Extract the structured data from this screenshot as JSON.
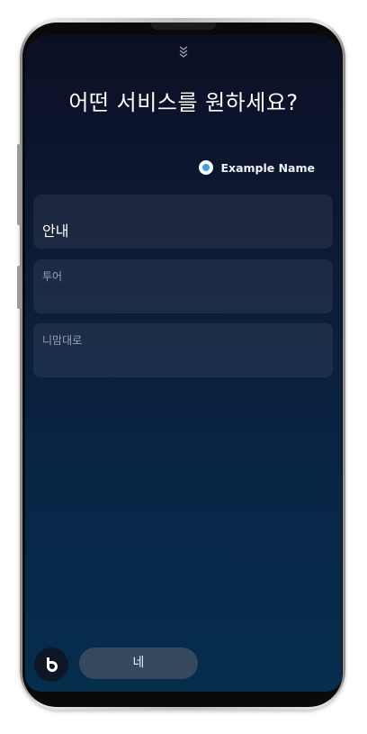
{
  "screen": {
    "title": "어떤 서비스를 원하세요?",
    "account_name": "Example Name"
  },
  "options": [
    {
      "label": "안내"
    },
    {
      "label": "투어"
    },
    {
      "label": "니맘대로"
    }
  ],
  "bottom": {
    "reply_label": "네"
  },
  "icons": {
    "pull": "chevron-double-down-icon",
    "account": "account-circle-icon",
    "assistant": "bixby-icon"
  },
  "colors": {
    "accent": "#3aa0e8",
    "chip": "#34495e"
  }
}
